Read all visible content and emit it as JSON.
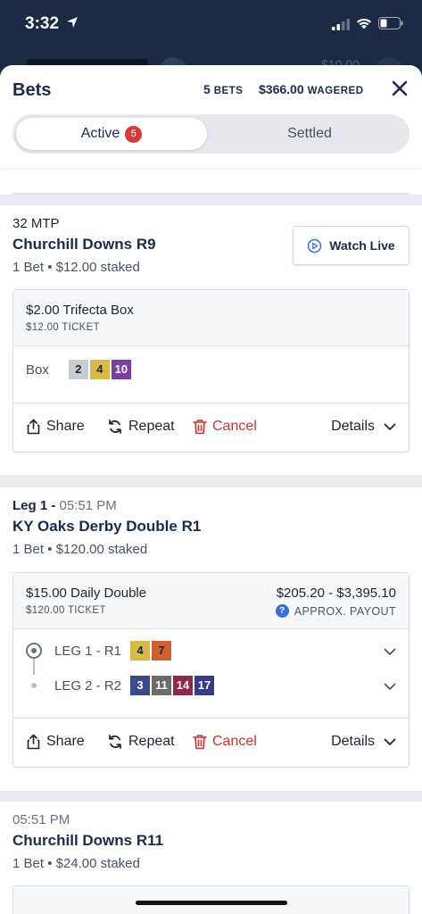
{
  "status_bar": {
    "time": "3:32"
  },
  "behind_header": {
    "balance": "$10.00"
  },
  "sheet": {
    "title": "Bets",
    "bet_count": "5",
    "bet_count_label": "BETS",
    "wagered_amount": "$366.00",
    "wagered_label": "WAGERED"
  },
  "tabs": {
    "active_label": "Active",
    "active_count": "5",
    "settled_label": "Settled"
  },
  "colors": {
    "cancel": "#c8332f",
    "badge": "#d63b3b",
    "navy": "#1d2b4a"
  },
  "bets": [
    {
      "meta": "32 MTP",
      "race": "Churchill Downs R9",
      "summary": "1 Bet • $12.00 staked",
      "watch_label": "Watch Live",
      "ticket_type": "$2.00 Trifecta Box",
      "ticket_cost": "$12.00 TICKET",
      "selection_label": "Box",
      "selections": [
        {
          "num": "2",
          "bg": "#c9cdd1",
          "fg": "#1d2433"
        },
        {
          "num": "4",
          "bg": "#d9b94a",
          "fg": "#1d2433"
        },
        {
          "num": "10",
          "bg": "#7a3fa0",
          "fg": "#ffffff"
        }
      ],
      "actions": {
        "share": "Share",
        "repeat": "Repeat",
        "cancel": "Cancel",
        "details": "Details"
      }
    },
    {
      "meta_leg": "Leg 1 - ",
      "meta_time": "05:51 PM",
      "race": "KY Oaks Derby Double R1",
      "summary": "1 Bet • $120.00 staked",
      "ticket_type": "$15.00 Daily Double",
      "ticket_cost": "$120.00 TICKET",
      "payout": "$205.20 - $3,395.10",
      "payout_label": "APPROX. PAYOUT",
      "legs": [
        {
          "label": "LEG 1 - R1",
          "selections": [
            {
              "num": "4",
              "bg": "#d9b94a",
              "fg": "#1d2433"
            },
            {
              "num": "7",
              "bg": "#d2602e",
              "fg": "#1d2433"
            }
          ]
        },
        {
          "label": "LEG 2 - R2",
          "selections": [
            {
              "num": "3",
              "bg": "#3b4a8c",
              "fg": "#ffffff"
            },
            {
              "num": "11",
              "bg": "#6b6b6b",
              "fg": "#ffffff"
            },
            {
              "num": "14",
              "bg": "#8c2a4a",
              "fg": "#ffffff"
            },
            {
              "num": "17",
              "bg": "#3c3a86",
              "fg": "#ffffff"
            }
          ]
        }
      ],
      "actions": {
        "share": "Share",
        "repeat": "Repeat",
        "cancel": "Cancel",
        "details": "Details"
      }
    },
    {
      "meta": "05:51 PM",
      "race": "Churchill Downs R11",
      "summary": "1 Bet • $24.00 staked"
    }
  ]
}
